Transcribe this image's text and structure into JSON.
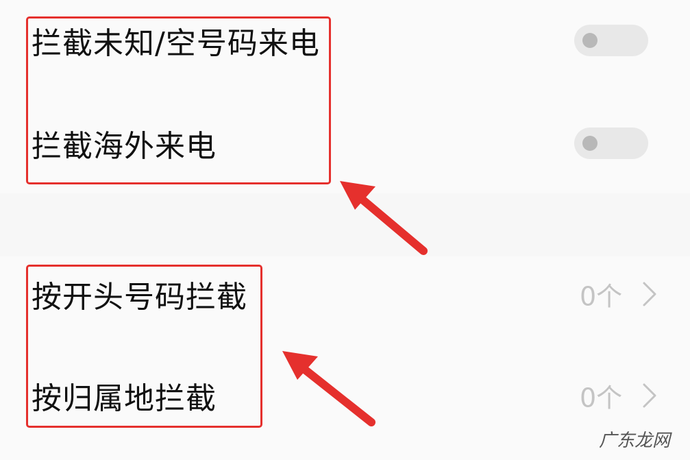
{
  "settings": {
    "rows": [
      {
        "label": "拦截未知/空号码来电",
        "control": "toggle",
        "enabled": false
      },
      {
        "label": "拦截海外来电",
        "control": "toggle",
        "enabled": false
      },
      {
        "label": "按开头号码拦截",
        "control": "link",
        "value": "0个"
      },
      {
        "label": "按归属地拦截",
        "control": "link",
        "value": "0个"
      }
    ]
  },
  "annotations": {
    "highlight_color": "#e5302d",
    "icons": [
      "chevron-right-icon",
      "red-arrow-annotation"
    ]
  },
  "watermark": {
    "text": "广东龙网"
  },
  "colors": {
    "label": "#111111",
    "value": "#c4c4c4",
    "toggle_track": "#e8e8e8",
    "toggle_knob": "#b8b8b8"
  }
}
